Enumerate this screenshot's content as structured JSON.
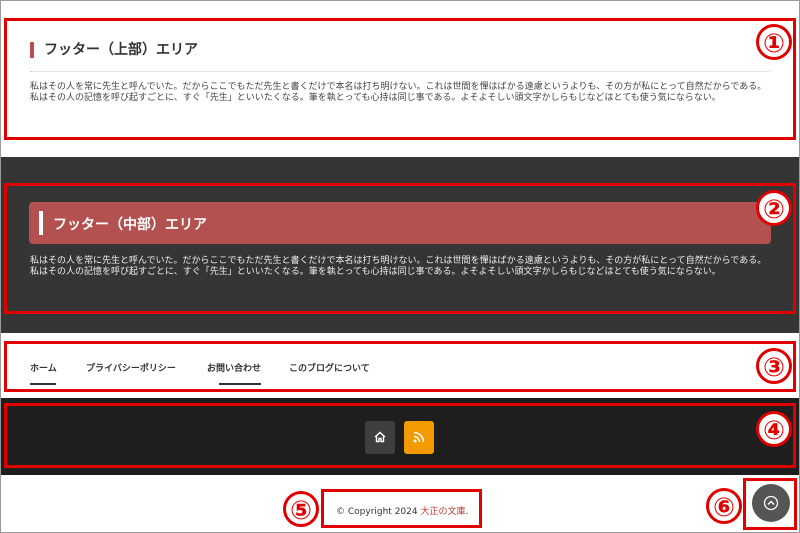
{
  "footer_top": {
    "title": "フッター（上部）エリア",
    "text": "私はその人を常に先生と呼んでいた。だからここでもただ先生と書くだけで本名は打ち明けない。これは世間を憚はばかる遠慮というよりも、その方が私にとって自然だからである。私はその人の記憶を呼び起すごとに、すぐ「先生」といいたくなる。筆を執とっても心持は同じ事である。よそよそしい頭文字かしらもじなどはとても使う気にならない。"
  },
  "footer_middle": {
    "title": "フッター（中部）エリア",
    "text": "私はその人を常に先生と呼んでいた。だからここでもただ先生と書くだけで本名は打ち明けない。これは世間を憚はばかる遠慮というよりも、その方が私にとって自然だからである。私はその人の記憶を呼び起すごとに、すぐ「先生」といいたくなる。筆を執とっても心持は同じ事である。よそよそしい頭文字かしらもじなどはとても使う気にならない。"
  },
  "footer_nav": {
    "items": [
      {
        "label": "ホーム"
      },
      {
        "label": "プライバシーポリシー"
      },
      {
        "label": "お問い合わせ"
      },
      {
        "label": "このブログについて"
      }
    ]
  },
  "social": {
    "icons": [
      "home-icon",
      "rss-icon"
    ],
    "colors": {
      "home": "#3f3f3f",
      "rss": "#f29a00"
    }
  },
  "copyright": {
    "prefix": "© Copyright 2024",
    "site": "大正の文庫",
    "suffix": "."
  },
  "annotations": {
    "numbers": [
      "①",
      "②",
      "③",
      "④",
      "⑤",
      "⑥"
    ],
    "color": "#e00000"
  }
}
